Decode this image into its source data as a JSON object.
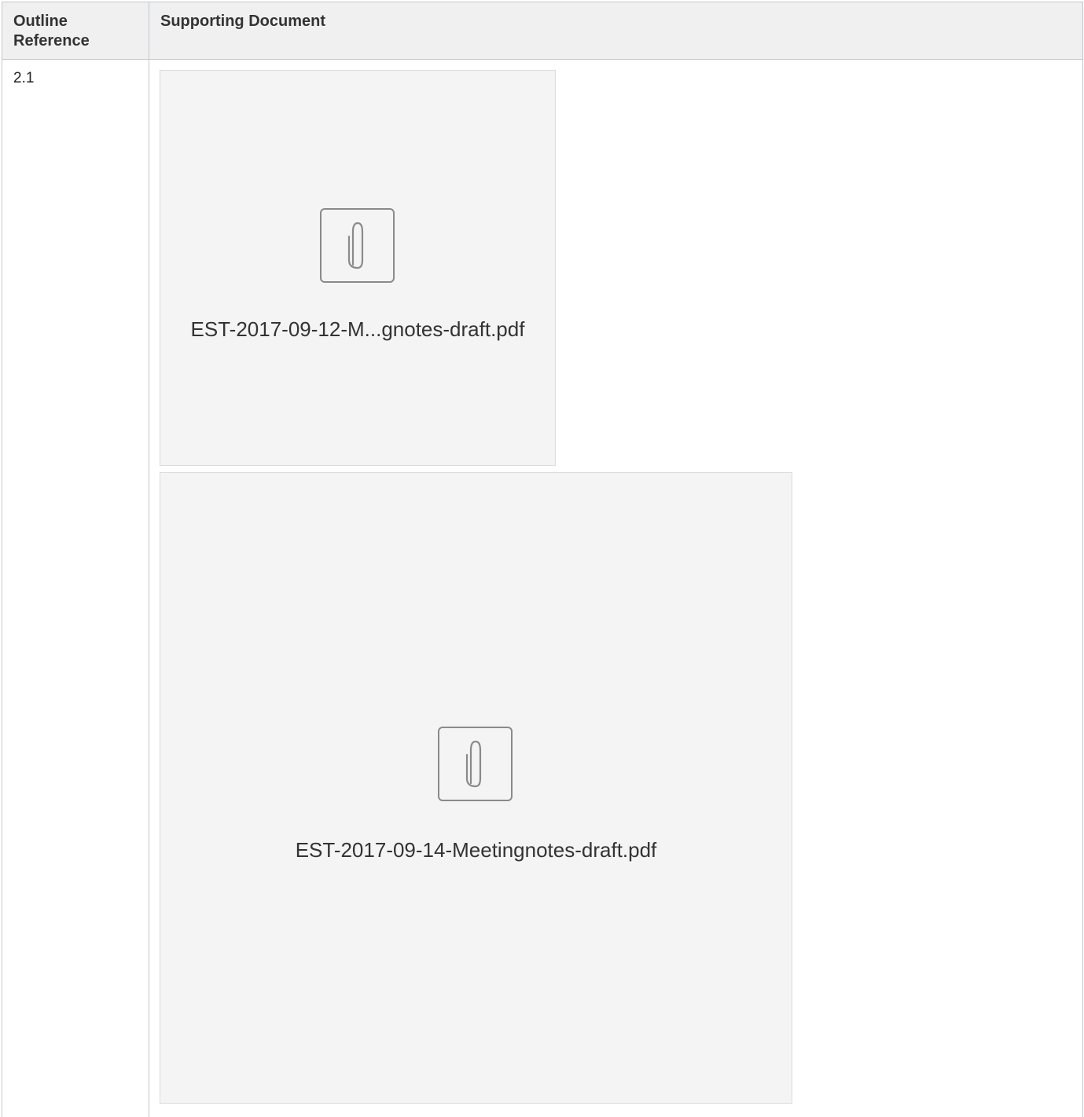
{
  "table": {
    "headers": {
      "outline_reference": "Outline Reference",
      "supporting_document": "Supporting Document"
    },
    "rows": [
      {
        "outline_reference": "2.1",
        "attachments": [
          {
            "filename": "EST-2017-09-12-M...gnotes-draft.pdf",
            "icon": "paperclip-icon"
          },
          {
            "filename": "EST-2017-09-14-Meetingnotes-draft.pdf",
            "icon": "paperclip-icon"
          }
        ]
      }
    ]
  }
}
